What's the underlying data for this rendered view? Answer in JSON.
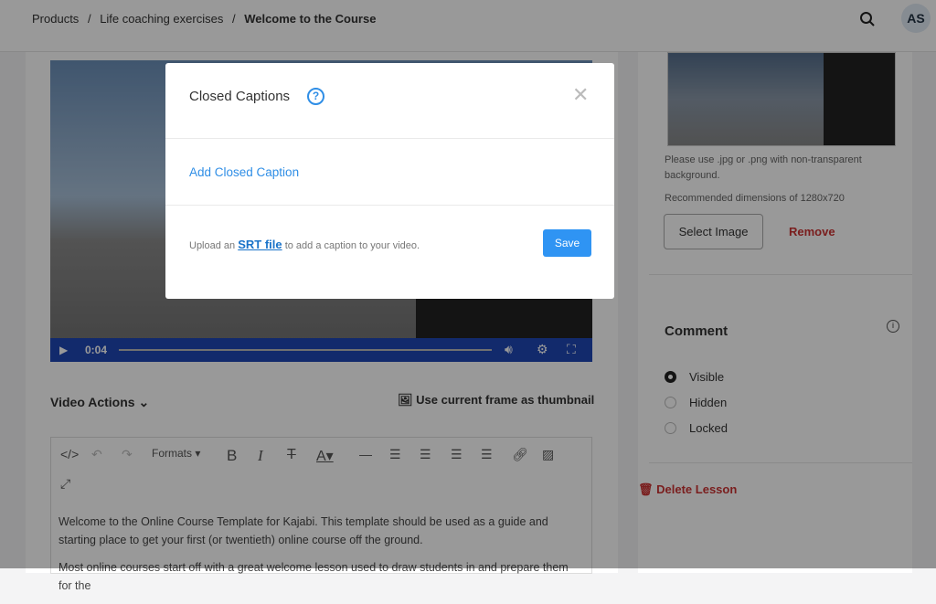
{
  "breadcrumb": [
    "Products",
    "Life coaching exercises",
    "Welcome to the Course"
  ],
  "breadcrumb_sep": "/",
  "user_initials": "AS",
  "video": {
    "time": "0:04"
  },
  "video_actions": "Video Actions",
  "thumbnail_button": "Use current frame as thumbnail",
  "editor": {
    "formats": "Formats",
    "paragraphs": [
      "Welcome to the Online Course Template for Kajabi. This template should be used as a guide and starting place to get your first (or twentieth) online course off the ground.",
      "Most online courses start off with a great welcome lesson used to draw students in and prepare them for the"
    ]
  },
  "sidebar": {
    "note1": "Please use .jpg or .png with non-transparent background.",
    "note2": "Recommended dimensions of 1280x720",
    "select_image": "Select Image",
    "remove": "Remove",
    "comment_title": "Comment",
    "comment_options": [
      {
        "label": "Visible",
        "selected": true
      },
      {
        "label": "Hidden",
        "selected": false
      },
      {
        "label": "Locked",
        "selected": false
      }
    ],
    "delete_lesson": "Delete Lesson"
  },
  "modal": {
    "title": "Closed Captions",
    "add_caption": "Add Closed Caption",
    "upload_prefix": "Upload an",
    "upload_link": "SRT file",
    "upload_suffix": "to add a caption to your video.",
    "save": "Save"
  },
  "colors": {
    "accent": "#2f94f3",
    "danger": "#cc3333",
    "video_bar": "#1e46b4"
  }
}
